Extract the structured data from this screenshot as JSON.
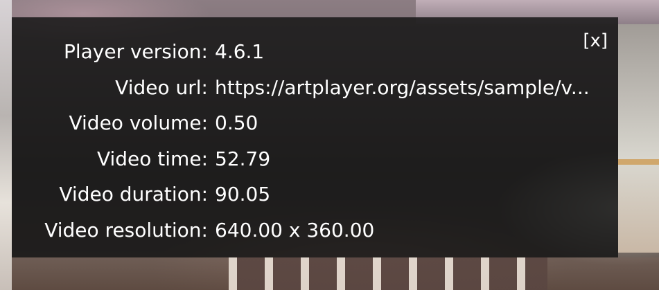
{
  "panel": {
    "close_label": "[x]",
    "rows": [
      {
        "label": "Player version:",
        "value": "4.6.1"
      },
      {
        "label": "Video url:",
        "value": "https://artplayer.org/assets/sample/v..."
      },
      {
        "label": "Video volume:",
        "value": "0.50"
      },
      {
        "label": "Video time:",
        "value": "52.79"
      },
      {
        "label": "Video duration:",
        "value": "90.05"
      },
      {
        "label": "Video resolution:",
        "value": "640.00 x 360.00"
      }
    ]
  },
  "colors": {
    "panel_background": "#161616",
    "text": "#ffffff"
  }
}
